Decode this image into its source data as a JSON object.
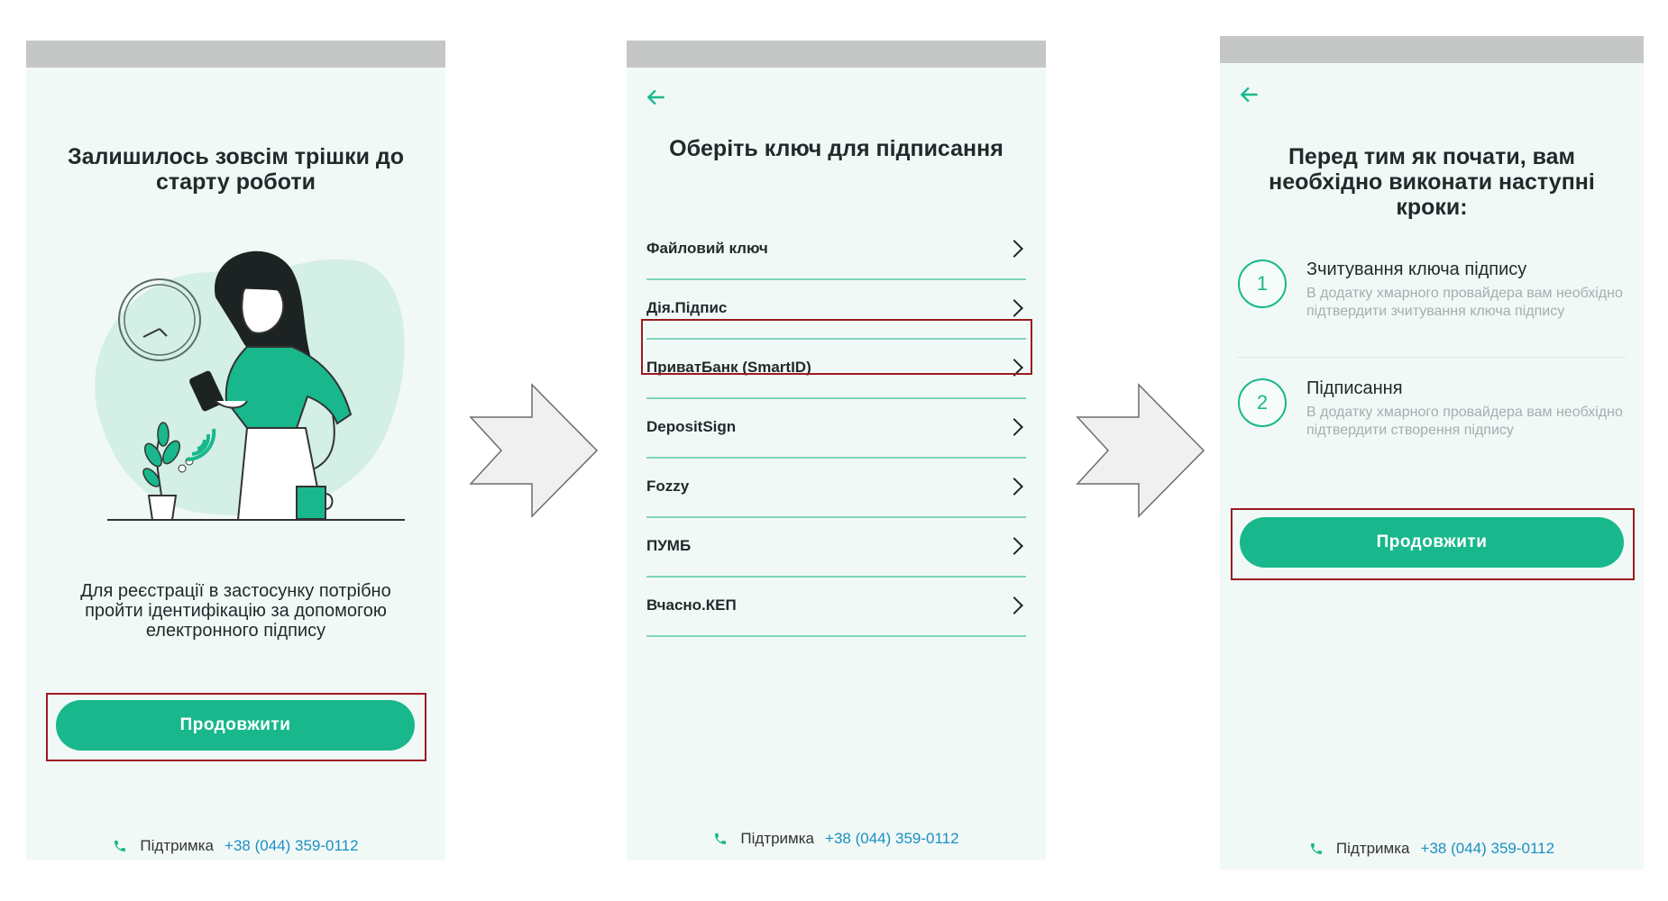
{
  "screen1": {
    "title": "Залишилось зовсім трішки до старту роботи",
    "description": "Для реєстрації в застосунку потрібно пройти ідентифікацію за допомогою електронного підпису",
    "button_label": "Продовжити",
    "support_label": "Підтримка",
    "support_phone": "+38 (044) 359-0112"
  },
  "screen2": {
    "title": "Оберіть ключ для підписання",
    "items": [
      {
        "label": "Файловий ключ"
      },
      {
        "label": "Дія.Підпис"
      },
      {
        "label": "ПриватБанк (SmartID)"
      },
      {
        "label": "DepositSign"
      },
      {
        "label": "Fozzy"
      },
      {
        "label": "ПУМБ"
      },
      {
        "label": "Вчасно.КЕП"
      }
    ],
    "support_label": "Підтримка",
    "support_phone": "+38 (044) 359-0112"
  },
  "screen3": {
    "title": "Перед тим як почати, вам необхідно виконати наступні кроки:",
    "steps": [
      {
        "number": "1",
        "title": "Зчитування ключа підпису",
        "description": "В додатку хмарного провайдера вам необхідно підтвердити зчитування ключа підпису"
      },
      {
        "number": "2",
        "title": "Підписання",
        "description": "В додатку хмарного провайдера вам необхідно підтвердити створення підпису"
      }
    ],
    "button_label": "Продовжити",
    "support_label": "Підтримка",
    "support_phone": "+38 (044) 359-0112"
  },
  "colors": {
    "accent": "#18b88c",
    "screen_bg": "#f1f9f7",
    "highlight_border": "#9a1b1f",
    "phone_link": "#1b8fc3"
  },
  "icons": [
    "back-arrow-icon",
    "chevron-right-icon",
    "phone-icon",
    "flow-arrow-icon"
  ]
}
